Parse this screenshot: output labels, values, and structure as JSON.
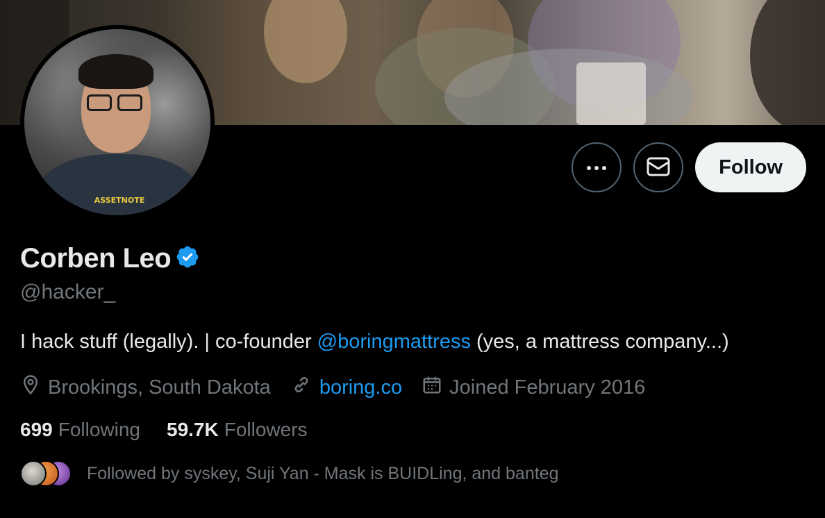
{
  "profile": {
    "display_name": "Corben Leo",
    "verified": true,
    "handle": "@hacker_",
    "bio_prefix": "I hack stuff (legally). | co-founder ",
    "bio_mention": "@boringmattress",
    "bio_suffix": " (yes, a mattress company...)",
    "location": "Brookings, South Dakota",
    "website": "boring.co",
    "joined": "Joined February 2016"
  },
  "stats": {
    "following_count": "699",
    "following_label": "Following",
    "followers_count": "59.7K",
    "followers_label": "Followers"
  },
  "followed_by": "Followed by syskey, Suji Yan - Mask is BUIDLing, and banteg",
  "actions": {
    "more_icon": "more-horizontal-icon",
    "message_icon": "envelope-icon",
    "follow_label": "Follow"
  },
  "colors": {
    "background": "#000000",
    "text_primary": "#e7e9ea",
    "text_secondary": "#71767b",
    "link": "#1d9bf0",
    "verified_badge": "#1d9bf0",
    "button_border": "#536471",
    "follow_button_bg": "#eff3f4"
  }
}
